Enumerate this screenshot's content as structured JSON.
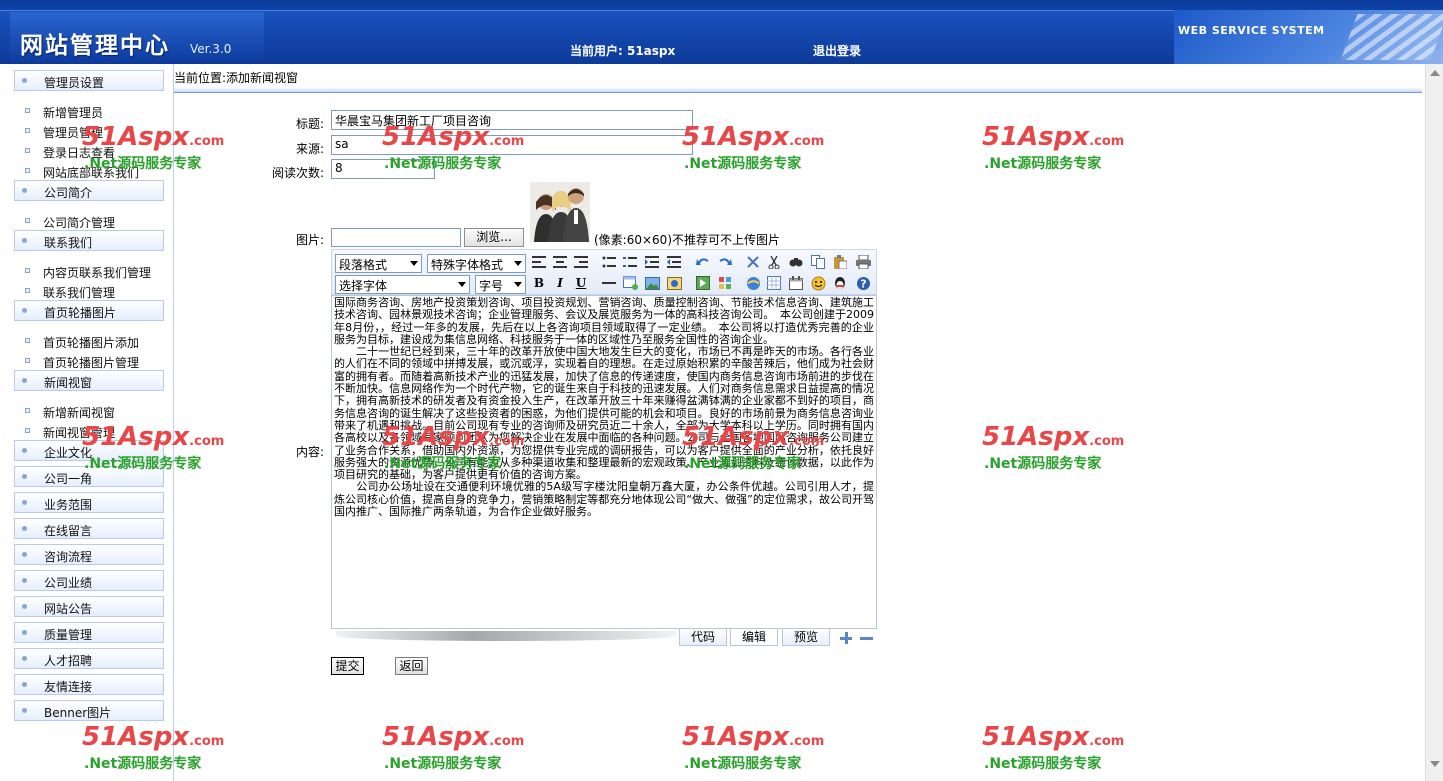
{
  "header": {
    "title": "网站管理中心",
    "version": "Ver.3.0",
    "current_user": "当前用户: 51aspx",
    "logout": "退出登录",
    "brand": "WEB SERVICE SYSTEM"
  },
  "sidebar": {
    "groups": [
      {
        "label": "管理员设置",
        "items": [
          "新增管理员",
          "管理员管理",
          "登录日志查看",
          "网站底部联系我们"
        ]
      },
      {
        "label": "公司简介",
        "items": [
          "公司简介管理"
        ]
      },
      {
        "label": "联系我们",
        "items": [
          "内容页联系我们管理",
          "联系我们管理"
        ]
      },
      {
        "label": "首页轮播图片",
        "items": [
          "首页轮播图片添加",
          "首页轮播图片管理"
        ]
      },
      {
        "label": "新闻视窗",
        "items": [
          "新增新闻视窗",
          "新闻视窗管理"
        ]
      },
      {
        "label": "企业文化",
        "items": []
      },
      {
        "label": "公司一角",
        "items": []
      },
      {
        "label": "业务范围",
        "items": []
      },
      {
        "label": "在线留言",
        "items": []
      },
      {
        "label": "咨询流程",
        "items": []
      },
      {
        "label": "公司业绩",
        "items": []
      },
      {
        "label": "网站公告",
        "items": []
      },
      {
        "label": "质量管理",
        "items": []
      },
      {
        "label": "人才招聘",
        "items": []
      },
      {
        "label": "友情连接",
        "items": []
      },
      {
        "label": "Benner图片",
        "items": []
      }
    ]
  },
  "breadcrumb": "当前位置:添加新闻视窗",
  "form": {
    "title_label": "标题:",
    "title_value": "华晨宝马集团新工厂项目咨询",
    "source_label": "来源:",
    "source_value": "sa",
    "views_label": "阅读次数:",
    "views_value": "8",
    "image_label": "图片:",
    "browse_label": "浏览...",
    "image_hint": "(像素:60×60)不推荐可不上传图片",
    "content_label": "内容:",
    "submit_label": "提交",
    "back_label": "返回"
  },
  "editor": {
    "paragraph_format": "段落格式",
    "special_font": "特殊字体格式",
    "font_select": "选择字体",
    "font_size": "字号",
    "bold": "B",
    "italic": "I",
    "underline": "U",
    "modes": [
      "代码",
      "编辑",
      "预览"
    ],
    "paragraphs": [
      "国际商务咨询、房地产投资策划咨询、项目投资规划、营销咨询、质量控制咨询、节能技术信息咨询、建筑施工技术咨询、园林景观技术咨询；企业管理服务、会议及展览服务为一体的高科技咨询公司。　本公司创建于2009年8月份，，经过一年多的发展，先后在以上各咨询项目领域取得了一定业绩。　本公司将以打造优秀完善的企业服务为目标，建设成为集信息网络、科技服务于一体的区域性乃至服务全国性的咨询企业。",
      "　　二十一世纪已经到来，三十年的改革开放使中国大地发生巨大的变化，市场已不再是昨天的市场。各行各业的人们在不同的领域中拼搏发展，或沉或浮，实现着自的理想。在走过原始积累的辛酸苦辣后，他们成为社会财富的拥有者。而随着高新技术产业的迅猛发展，加快了信息的传递速度，使国内商务信息咨询市场前进的步伐在不断加快。信息网络作为一个时代产物，它的诞生来自于科技的迅速发展。人们对商务信息需求日益提高的情况下，拥有高新技术的研发者及有资金投入生产，在改革开放三十年来赚得盆满钵满的企业家都不到好的项目，商务信息咨询的诞生解决了这些投资者的困惑，为他们提供可能的机会和项目。良好的市场前景为商务信息咨询业带来了机遇和挑战。目前公司现有专业的咨询师及研究员近二十余人，全部为大学本科以上学历。同时拥有国内各高校以及各领域专家顾问团队为您解决企业在发展中面临的各种问题。公司与全国各地国际咨询服务公司建立了业务合作关系，借助国内外资源，为您提供专业完成的调研报告，可以为客户提供全面的产业分析，依托良好服务强大的资源优势，公司有能力从多种渠道收集和整理最新的宏观政策、产业规划资料及统计数据，以此作为项目研究的基础，为客户提供更有价值的咨询方案。",
      "　　公司办公场址设在交通便利环境优雅的5A级写字楼沈阳皇朝万鑫大厦，办公条件优越。公司引用人才，提炼公司核心价值，提高自身的竞争力，营销策略制定等都充分地体现公司“做大、做强”的定位需求，故公司开驾国内推广、国际推广两条轨道，为合作企业做好服务。"
    ]
  },
  "watermark": {
    "brand": "51Aspx",
    "domain": ".com",
    "slogan": ".Net源码服务专家"
  },
  "colors": {
    "header_blue": "#1a52bd",
    "watermark_red": "#e8474a",
    "watermark_green": "#2aa12c"
  }
}
